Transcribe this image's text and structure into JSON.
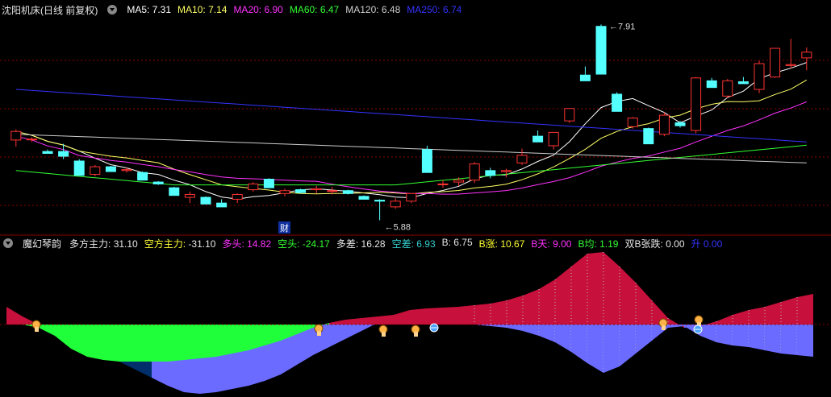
{
  "main": {
    "title": "沈阳机床(日线 前复权)",
    "ma": [
      {
        "label": "MA5:",
        "value": "7.31",
        "color": "#ffffff"
      },
      {
        "label": "MA10:",
        "value": "7.14",
        "color": "#ffff66"
      },
      {
        "label": "MA20:",
        "value": "6.90",
        "color": "#ff33ff"
      },
      {
        "label": "MA60:",
        "value": "6.47",
        "color": "#33ff33"
      },
      {
        "label": "MA120:",
        "value": "6.48",
        "color": "#cccccc"
      },
      {
        "label": "MA250:",
        "value": "6.74",
        "color": "#3333ff"
      }
    ],
    "high_label": "7.91",
    "low_label": "5.88",
    "finance_marker": "财",
    "candles": [
      [
        6.72,
        6.83,
        6.65,
        6.81
      ],
      [
        6.73,
        6.75,
        6.7,
        6.73
      ],
      [
        6.6,
        6.62,
        6.58,
        6.58
      ],
      [
        6.6,
        6.68,
        6.52,
        6.55
      ],
      [
        6.5,
        6.52,
        6.35,
        6.35
      ],
      [
        6.36,
        6.46,
        6.34,
        6.44
      ],
      [
        6.44,
        6.45,
        6.39,
        6.39
      ],
      [
        6.4,
        6.43,
        6.38,
        6.41
      ],
      [
        6.38,
        6.39,
        6.3,
        6.3
      ],
      [
        6.28,
        6.29,
        6.25,
        6.26
      ],
      [
        6.22,
        6.23,
        6.14,
        6.14
      ],
      [
        6.12,
        6.18,
        6.06,
        6.15
      ],
      [
        6.12,
        6.13,
        6.05,
        6.05
      ],
      [
        6.06,
        6.1,
        6.02,
        6.02
      ],
      [
        6.1,
        6.16,
        6.06,
        6.15
      ],
      [
        6.2,
        6.28,
        6.18,
        6.26
      ],
      [
        6.31,
        6.32,
        6.22,
        6.22
      ],
      [
        6.16,
        6.21,
        6.13,
        6.19
      ],
      [
        6.2,
        6.21,
        6.16,
        6.17
      ],
      [
        6.2,
        6.24,
        6.16,
        6.21
      ],
      [
        6.19,
        6.23,
        6.15,
        6.19
      ],
      [
        6.19,
        6.2,
        6.15,
        6.16
      ],
      [
        6.13,
        6.14,
        6.1,
        6.1
      ],
      [
        6.09,
        6.1,
        5.88,
        6.08
      ],
      [
        6.02,
        6.11,
        6.0,
        6.08
      ],
      [
        6.08,
        6.16,
        6.06,
        6.16
      ],
      [
        6.62,
        6.66,
        6.38,
        6.38
      ],
      [
        6.26,
        6.3,
        6.22,
        6.26
      ],
      [
        6.28,
        6.33,
        6.24,
        6.3
      ],
      [
        6.3,
        6.49,
        6.27,
        6.47
      ],
      [
        6.4,
        6.43,
        6.32,
        6.35
      ],
      [
        6.39,
        6.42,
        6.33,
        6.4
      ],
      [
        6.48,
        6.63,
        6.46,
        6.56
      ],
      [
        6.76,
        6.82,
        6.7,
        6.7
      ],
      [
        6.66,
        6.8,
        6.62,
        6.8
      ],
      [
        6.92,
        7.05,
        6.9,
        7.05
      ],
      [
        7.4,
        7.49,
        7.34,
        7.34
      ],
      [
        7.91,
        7.93,
        7.41,
        7.41
      ],
      [
        7.2,
        7.22,
        7.02,
        7.02
      ],
      [
        6.86,
        6.96,
        6.84,
        6.95
      ],
      [
        6.84,
        6.85,
        6.68,
        6.68
      ],
      [
        6.78,
        7.01,
        6.76,
        6.98
      ],
      [
        6.9,
        6.92,
        6.85,
        6.87
      ],
      [
        6.82,
        7.38,
        6.79,
        7.37
      ],
      [
        7.34,
        7.37,
        7.27,
        7.27
      ],
      [
        7.18,
        7.36,
        7.16,
        7.34
      ],
      [
        7.33,
        7.38,
        7.31,
        7.31
      ],
      [
        7.25,
        7.55,
        7.21,
        7.52
      ],
      [
        7.38,
        7.68,
        7.37,
        7.68
      ],
      [
        7.5,
        7.78,
        7.47,
        7.51
      ],
      [
        7.58,
        7.69,
        7.45,
        7.64
      ]
    ]
  },
  "indicator": {
    "title": "魔幻琴韵",
    "stats": [
      {
        "label": "多方主力:",
        "value": "31.10",
        "color": "#e6e6e6",
        "labelColor": "#e6e6e6"
      },
      {
        "label": "空方主力:",
        "value": "-31.10",
        "color": "#e6e6e6",
        "labelColor": "#ffff33"
      },
      {
        "label": "多头:",
        "value": "14.82",
        "color": "#ff33ff",
        "labelColor": "#ff33ff"
      },
      {
        "label": "空头:",
        "value": "-24.17",
        "color": "#33ff33",
        "labelColor": "#33ff33"
      },
      {
        "label": "多差:",
        "value": "16.28",
        "color": "#e6e6e6",
        "labelColor": "#e6e6e6"
      },
      {
        "label": "空差:",
        "value": "6.93",
        "color": "#33cccc",
        "labelColor": "#33cccc"
      },
      {
        "label": "B:",
        "value": "6.75",
        "color": "#e6e6e6",
        "labelColor": "#e6e6e6"
      },
      {
        "label": "B涨:",
        "value": "10.67",
        "color": "#ffff33",
        "labelColor": "#ffff33"
      },
      {
        "label": "B天:",
        "value": "9.00",
        "color": "#ff33ff",
        "labelColor": "#ff33ff"
      },
      {
        "label": "B均:",
        "value": "1.19",
        "color": "#33ff33",
        "labelColor": "#33ff33"
      },
      {
        "label": "双B张跌:",
        "value": "0.00",
        "color": "#e6e6e6",
        "labelColor": "#e6e6e6"
      },
      {
        "label": "升",
        "value": "0.00",
        "color": "#3333ff",
        "labelColor": "#3333ff"
      }
    ]
  },
  "colors": {
    "up": "#ff3333",
    "down": "#54ffff",
    "grid": "#8b0000",
    "band_red": "#c8103c",
    "band_blue": "#6b6bff",
    "band_navy": "#002f6c",
    "band_green": "#1fff3a"
  }
}
